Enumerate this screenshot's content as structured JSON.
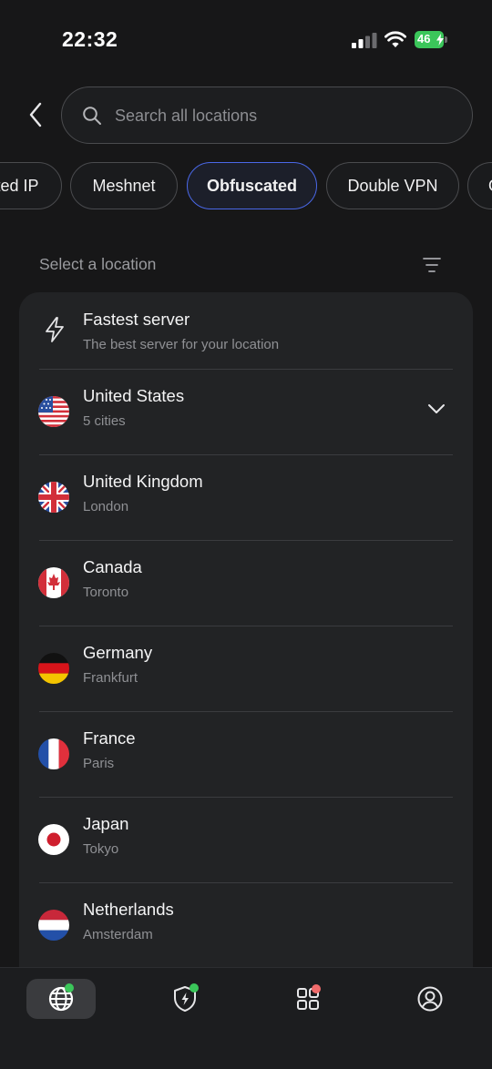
{
  "status_bar": {
    "time": "22:32",
    "battery": "46"
  },
  "search": {
    "placeholder": "Search all locations"
  },
  "chips": [
    "ted IP",
    "Meshnet",
    "Obfuscated",
    "Double VPN",
    "O"
  ],
  "active_chip": "Obfuscated",
  "section": {
    "label": "Select a location"
  },
  "fastest": {
    "title": "Fastest server",
    "subtitle": "The best server for your location"
  },
  "countries": [
    {
      "name": "United States",
      "detail": "5 cities",
      "flag": "us-flag"
    },
    {
      "name": "United Kingdom",
      "detail": "London",
      "flag": "uk-flag"
    },
    {
      "name": "Canada",
      "detail": "Toronto",
      "flag": "canada-flag"
    },
    {
      "name": "Germany",
      "detail": "Frankfurt",
      "flag": "germany-flag"
    },
    {
      "name": "France",
      "detail": "Paris",
      "flag": "france-flag"
    },
    {
      "name": "Japan",
      "detail": "Tokyo",
      "flag": "japan-flag"
    },
    {
      "name": "Netherlands",
      "detail": "Amsterdam",
      "flag": "netherlands-flag"
    }
  ],
  "tabs": [
    {
      "icon": "globe-icon",
      "badge": "#3bc65a",
      "active": true
    },
    {
      "icon": "shield-bolt-icon",
      "badge": "#3bc65a",
      "active": false
    },
    {
      "icon": "apps-grid-icon",
      "badge": "#f06b6b",
      "active": false
    },
    {
      "icon": "profile-icon",
      "badge": "",
      "active": false
    }
  ],
  "colors": {
    "accent": "#4a68e8",
    "background": "#171718",
    "card": "#222325",
    "connected": "#3bc65a",
    "alert": "#f06b6b"
  }
}
